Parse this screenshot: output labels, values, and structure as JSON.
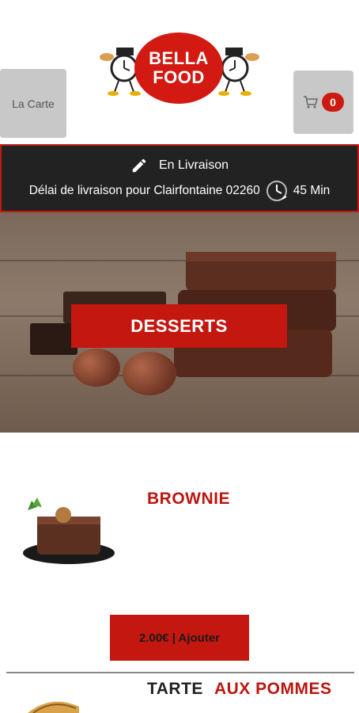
{
  "header": {
    "menu_label": "La Carte",
    "cart_count": "0",
    "logo_line1": "BELLA",
    "logo_line2": "FOOD"
  },
  "delivery": {
    "mode": "En Livraison",
    "delay_text": "Délai de livraison pour Clairfontaine 02260",
    "duration": "45 Min"
  },
  "category": {
    "title": "DESSERTS"
  },
  "products": [
    {
      "name": "BROWNIE",
      "add_label": "2.00€ | Ajouter"
    },
    {
      "name_part1": "TARTE",
      "name_part2": "AUX POMMES"
    }
  ],
  "colors": {
    "brand_red": "#c4170f",
    "banner_bg": "#222222",
    "button_gray": "#c8c8c8"
  },
  "icons": [
    "pencil-icon",
    "clock-icon",
    "cart-icon"
  ]
}
